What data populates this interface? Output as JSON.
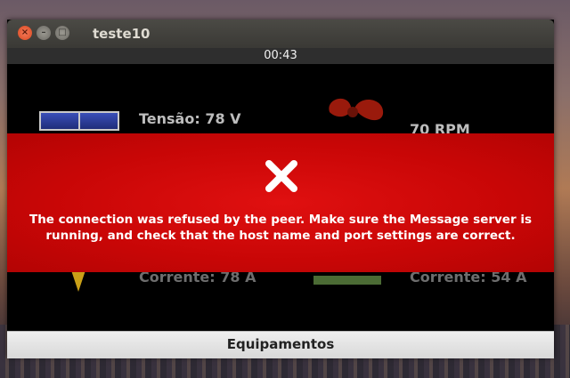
{
  "window": {
    "title": "teste10",
    "controls": {
      "close": "×",
      "minimize": "–",
      "maximize": "□"
    }
  },
  "timer": "00:43",
  "stats": {
    "voltage": "Tensão: 78 V",
    "rpm": "70 RPM",
    "current_left": "Corrente: 78 A",
    "current_right": "Corrente: 54 A"
  },
  "error": {
    "icon": "close-icon",
    "message": "The connection was refused by the peer. Make sure the Message server is running, and check that the host name and port settings are correct."
  },
  "bottom_tab": {
    "label": "Equipamentos"
  },
  "colors": {
    "error_bg": "#d40808",
    "content_bg": "#000000",
    "title_bar": "#3e3d39"
  }
}
